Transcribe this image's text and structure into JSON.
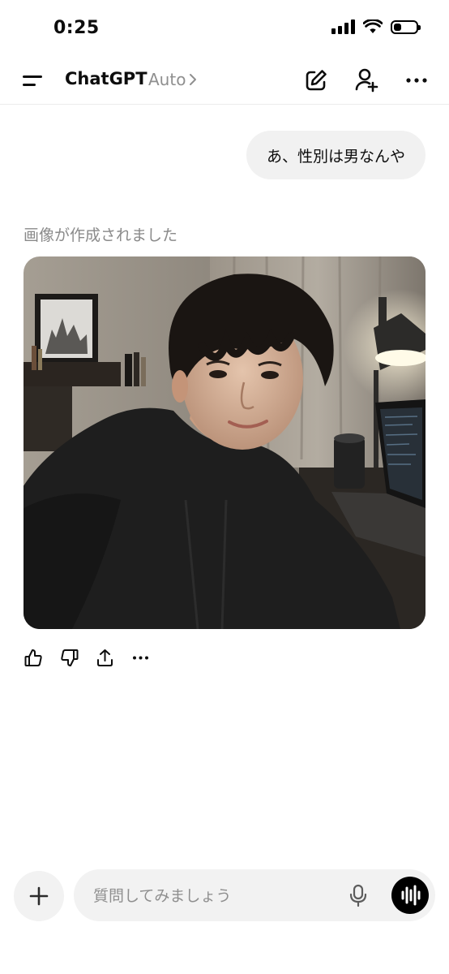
{
  "status_bar": {
    "time": "0:25",
    "battery_level": 0.35
  },
  "header": {
    "app_title": "ChatGPT",
    "model_label": "Auto"
  },
  "icons": {
    "menu": "menu-icon",
    "new_chat": "compose-icon",
    "add_person": "add-person-icon",
    "more": "ellipsis-icon",
    "thumbs_up": "thumbs-up-icon",
    "thumbs_down": "thumbs-down-icon",
    "share": "share-icon",
    "plus": "plus-icon",
    "mic": "microphone-icon",
    "voice": "voice-waveform-icon"
  },
  "conversation": {
    "user_message": "あ、性別は男なんや",
    "image_caption": "画像が作成されました"
  },
  "composer": {
    "placeholder": "質問してみましょう"
  },
  "colors": {
    "accent": "#000000",
    "bubble": "#f1f1f1",
    "muted_text": "#8a8a8a"
  }
}
